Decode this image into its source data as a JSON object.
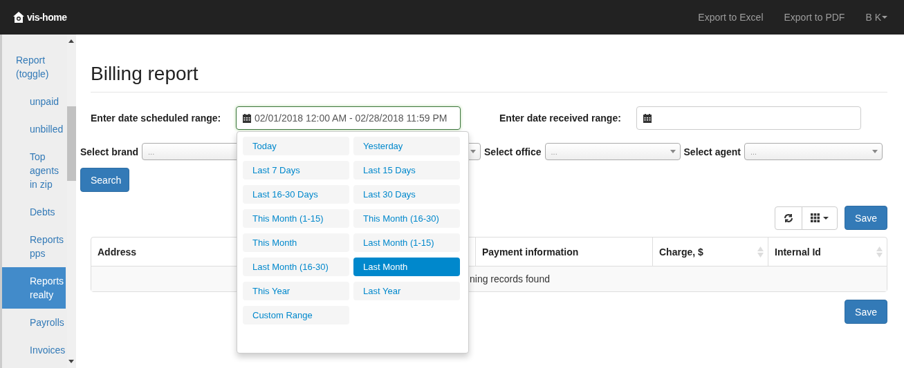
{
  "header": {
    "logo": "vis-home",
    "links": [
      "Export to Excel",
      "Export to PDF"
    ],
    "user": "B K"
  },
  "sidebar": {
    "items": [
      {
        "label": "Report (toggle)",
        "selected": false,
        "children": [
          {
            "label": "unpaid",
            "selected": false
          },
          {
            "label": "unbilled",
            "selected": false
          },
          {
            "label": "Top agents in zip",
            "selected": false
          },
          {
            "label": "Debts",
            "selected": false
          },
          {
            "label": "Reports pps",
            "selected": false
          },
          {
            "label": "Reports realty",
            "selected": true
          },
          {
            "label": "Payrolls",
            "selected": false
          },
          {
            "label": "Invoices",
            "selected": false
          }
        ]
      }
    ]
  },
  "page": {
    "title": "Billing report"
  },
  "date_filters": [
    {
      "label": "Enter date scheduled range:",
      "value": "02/01/2018 12:00 AM - 02/28/2018 11:59 PM",
      "focused": true
    },
    {
      "label": "Enter date received range:",
      "focused": false
    }
  ],
  "selects": [
    {
      "label": "Select brand",
      "placeholder": "..."
    },
    {
      "label": "Select office",
      "placeholder": "..."
    },
    {
      "label": "Select agent",
      "placeholder": "..."
    }
  ],
  "search_button": "Search",
  "save_buttons": [
    "Save",
    "Save"
  ],
  "table": {
    "columns": [
      {
        "label": "Address",
        "sortable": false
      },
      {
        "label": "Payment information",
        "sortable": false
      },
      {
        "label": "Charge, $",
        "sortable": true
      },
      {
        "label": "Internal Id",
        "sortable": true
      }
    ],
    "empty_message": "ning records found"
  },
  "range_menu": {
    "options": [
      {
        "label": "Today",
        "selected": false
      },
      {
        "label": "Yesterday",
        "selected": false
      },
      {
        "label": "Last 7 Days",
        "selected": false
      },
      {
        "label": "Last 15 Days",
        "selected": false
      },
      {
        "label": "Last 16-30 Days",
        "selected": false
      },
      {
        "label": "Last 30 Days",
        "selected": false
      },
      {
        "label": "This Month (1-15)",
        "selected": false
      },
      {
        "label": "This Month (16-30)",
        "selected": false
      },
      {
        "label": "This Month",
        "selected": false
      },
      {
        "label": "Last Month (1-15)",
        "selected": false
      },
      {
        "label": "Last Month (16-30)",
        "selected": false
      },
      {
        "label": "Last Month",
        "selected": true
      },
      {
        "label": "This Year",
        "selected": false
      },
      {
        "label": "Last Year",
        "selected": false
      },
      {
        "label": "Custom Range",
        "selected": false
      }
    ]
  }
}
